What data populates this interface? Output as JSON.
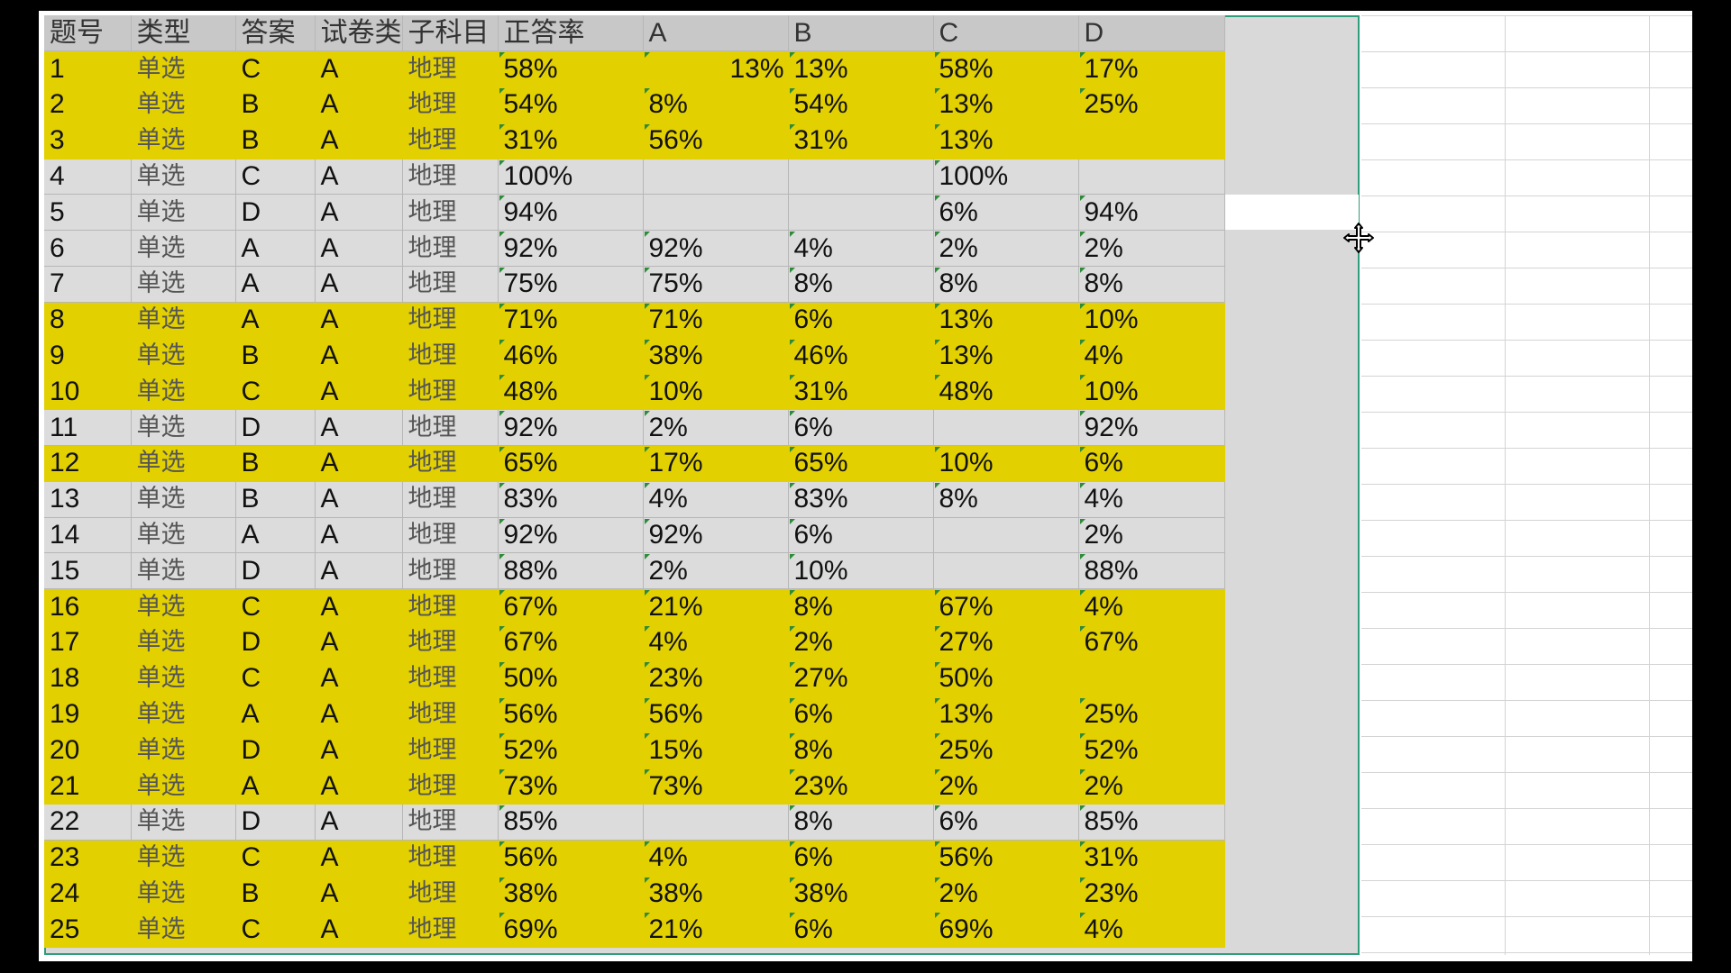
{
  "spreadsheet": {
    "headers": [
      "题号",
      "类型",
      "答案",
      "试卷类",
      "子科目",
      "正答率",
      "A",
      "B",
      "C",
      "D"
    ],
    "colors": {
      "highlight": "#e2d000",
      "normal_row": "#dcdcdc",
      "header": "#c8c8c8",
      "selection_border": "#2f9c7a"
    },
    "rows": [
      {
        "no": "1",
        "type": "单选",
        "answer": "C",
        "paper": "A",
        "subject": "地理",
        "rate": "58%",
        "a": "13%",
        "b": "13%",
        "c": "58%",
        "d": "17%",
        "highlight": true
      },
      {
        "no": "2",
        "type": "单选",
        "answer": "B",
        "paper": "A",
        "subject": "地理",
        "rate": "54%",
        "a": "8%",
        "b": "54%",
        "c": "13%",
        "d": "25%",
        "highlight": true
      },
      {
        "no": "3",
        "type": "单选",
        "answer": "B",
        "paper": "A",
        "subject": "地理",
        "rate": "31%",
        "a": "56%",
        "b": "31%",
        "c": "13%",
        "d": "",
        "highlight": true
      },
      {
        "no": "4",
        "type": "单选",
        "answer": "C",
        "paper": "A",
        "subject": "地理",
        "rate": "100%",
        "a": "",
        "b": "",
        "c": "100%",
        "d": "",
        "highlight": false
      },
      {
        "no": "5",
        "type": "单选",
        "answer": "D",
        "paper": "A",
        "subject": "地理",
        "rate": "94%",
        "a": "",
        "b": "",
        "c": "6%",
        "d": "94%",
        "highlight": false
      },
      {
        "no": "6",
        "type": "单选",
        "answer": "A",
        "paper": "A",
        "subject": "地理",
        "rate": "92%",
        "a": "92%",
        "b": "4%",
        "c": "2%",
        "d": "2%",
        "highlight": false
      },
      {
        "no": "7",
        "type": "单选",
        "answer": "A",
        "paper": "A",
        "subject": "地理",
        "rate": "75%",
        "a": "75%",
        "b": "8%",
        "c": "8%",
        "d": "8%",
        "highlight": false
      },
      {
        "no": "8",
        "type": "单选",
        "answer": "A",
        "paper": "A",
        "subject": "地理",
        "rate": "71%",
        "a": "71%",
        "b": "6%",
        "c": "13%",
        "d": "10%",
        "highlight": true
      },
      {
        "no": "9",
        "type": "单选",
        "answer": "B",
        "paper": "A",
        "subject": "地理",
        "rate": "46%",
        "a": "38%",
        "b": "46%",
        "c": "13%",
        "d": "4%",
        "highlight": true
      },
      {
        "no": "10",
        "type": "单选",
        "answer": "C",
        "paper": "A",
        "subject": "地理",
        "rate": "48%",
        "a": "10%",
        "b": "31%",
        "c": "48%",
        "d": "10%",
        "highlight": true
      },
      {
        "no": "11",
        "type": "单选",
        "answer": "D",
        "paper": "A",
        "subject": "地理",
        "rate": "92%",
        "a": "2%",
        "b": "6%",
        "c": "",
        "d": "92%",
        "highlight": false
      },
      {
        "no": "12",
        "type": "单选",
        "answer": "B",
        "paper": "A",
        "subject": "地理",
        "rate": "65%",
        "a": "17%",
        "b": "65%",
        "c": "10%",
        "d": "6%",
        "highlight": true
      },
      {
        "no": "13",
        "type": "单选",
        "answer": "B",
        "paper": "A",
        "subject": "地理",
        "rate": "83%",
        "a": "4%",
        "b": "83%",
        "c": "8%",
        "d": "4%",
        "highlight": false
      },
      {
        "no": "14",
        "type": "单选",
        "answer": "A",
        "paper": "A",
        "subject": "地理",
        "rate": "92%",
        "a": "92%",
        "b": "6%",
        "c": "",
        "d": "2%",
        "highlight": false
      },
      {
        "no": "15",
        "type": "单选",
        "answer": "D",
        "paper": "A",
        "subject": "地理",
        "rate": "88%",
        "a": "2%",
        "b": "10%",
        "c": "",
        "d": "88%",
        "highlight": false
      },
      {
        "no": "16",
        "type": "单选",
        "answer": "C",
        "paper": "A",
        "subject": "地理",
        "rate": "67%",
        "a": "21%",
        "b": "8%",
        "c": "67%",
        "d": "4%",
        "highlight": true
      },
      {
        "no": "17",
        "type": "单选",
        "answer": "D",
        "paper": "A",
        "subject": "地理",
        "rate": "67%",
        "a": "4%",
        "b": "2%",
        "c": "27%",
        "d": "67%",
        "highlight": true
      },
      {
        "no": "18",
        "type": "单选",
        "answer": "C",
        "paper": "A",
        "subject": "地理",
        "rate": "50%",
        "a": "23%",
        "b": "27%",
        "c": "50%",
        "d": "",
        "highlight": true
      },
      {
        "no": "19",
        "type": "单选",
        "answer": "A",
        "paper": "A",
        "subject": "地理",
        "rate": "56%",
        "a": "56%",
        "b": "6%",
        "c": "13%",
        "d": "25%",
        "highlight": true
      },
      {
        "no": "20",
        "type": "单选",
        "answer": "D",
        "paper": "A",
        "subject": "地理",
        "rate": "52%",
        "a": "15%",
        "b": "8%",
        "c": "25%",
        "d": "52%",
        "highlight": true
      },
      {
        "no": "21",
        "type": "单选",
        "answer": "A",
        "paper": "A",
        "subject": "地理",
        "rate": "73%",
        "a": "73%",
        "b": "23%",
        "c": "2%",
        "d": "2%",
        "highlight": true
      },
      {
        "no": "22",
        "type": "单选",
        "answer": "D",
        "paper": "A",
        "subject": "地理",
        "rate": "85%",
        "a": "",
        "b": "8%",
        "c": "6%",
        "d": "85%",
        "highlight": false
      },
      {
        "no": "23",
        "type": "单选",
        "answer": "C",
        "paper": "A",
        "subject": "地理",
        "rate": "56%",
        "a": "4%",
        "b": "6%",
        "c": "56%",
        "d": "31%",
        "highlight": true
      },
      {
        "no": "24",
        "type": "单选",
        "answer": "B",
        "paper": "A",
        "subject": "地理",
        "rate": "38%",
        "a": "38%",
        "b": "38%",
        "c": "2%",
        "d": "23%",
        "highlight": true
      },
      {
        "no": "25",
        "type": "单选",
        "answer": "C",
        "paper": "A",
        "subject": "地理",
        "rate": "69%",
        "a": "21%",
        "b": "6%",
        "c": "69%",
        "d": "4%",
        "highlight": true
      }
    ]
  },
  "cursor": {
    "icon": "move-cursor-icon"
  }
}
